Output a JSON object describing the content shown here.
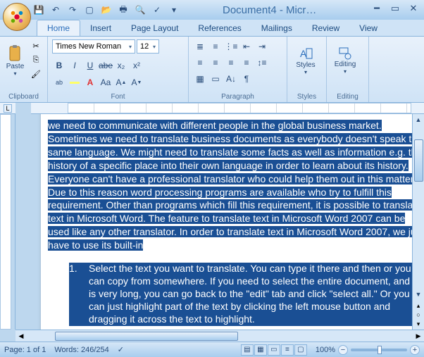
{
  "window": {
    "title": "Document4 - Micr…",
    "qat_icons": [
      "save",
      "undo",
      "redo",
      "new",
      "open",
      "print",
      "preview",
      "spell",
      "table"
    ]
  },
  "tabs": {
    "items": [
      "Home",
      "Insert",
      "Page Layout",
      "References",
      "Mailings",
      "Review",
      "View"
    ],
    "active": 0
  },
  "ribbon": {
    "clipboard": {
      "label": "Clipboard",
      "paste": "Paste"
    },
    "font": {
      "label": "Font",
      "name": "Times New Roman",
      "size": "12",
      "buttons_row1": [
        "B",
        "I",
        "U",
        "abe",
        "x₂",
        "x²"
      ],
      "buttons_row2": [
        "aby",
        "A",
        "Aa",
        "A▲",
        "A▼"
      ]
    },
    "paragraph": {
      "label": "Paragraph"
    },
    "styles": {
      "label": "Styles",
      "btn": "Styles"
    },
    "editing": {
      "label": "Editing",
      "btn": "Editing"
    }
  },
  "document": {
    "para1": "we need to communicate with different people in the global business market. Sometimes we need to translate business documents as everybody doesn't speak the same language. We might need to translate some facts as well as information e.g. the history of a specific place into their own language in order to learn about its history. Everyone can't have a professional translator who could help them out in this matter. Due to this reason word processing programs are available who try to fulfill this requirement. Other than programs which fill this requirement, it is possible to translate text in Microsoft Word. The feature to translate text in Microsoft Word 2007 can be used like any other translator. In order to translate text in Microsoft Word 2007, we just have to use its built-in",
    "list1_num": "1.",
    "list1": "Select the text you want to translate. You can type it there and then or you can copy from somewhere. If you need to select the entire document, and if it is very long, you can go back to the \"edit\" tab and click \"select all.\" Or you can just highlight part of the text by clicking the left mouse button and dragging it across the text to highlight."
  },
  "status": {
    "page": "Page: 1 of 1",
    "words": "Words: 246/254",
    "lang": "",
    "zoom": "100%"
  }
}
